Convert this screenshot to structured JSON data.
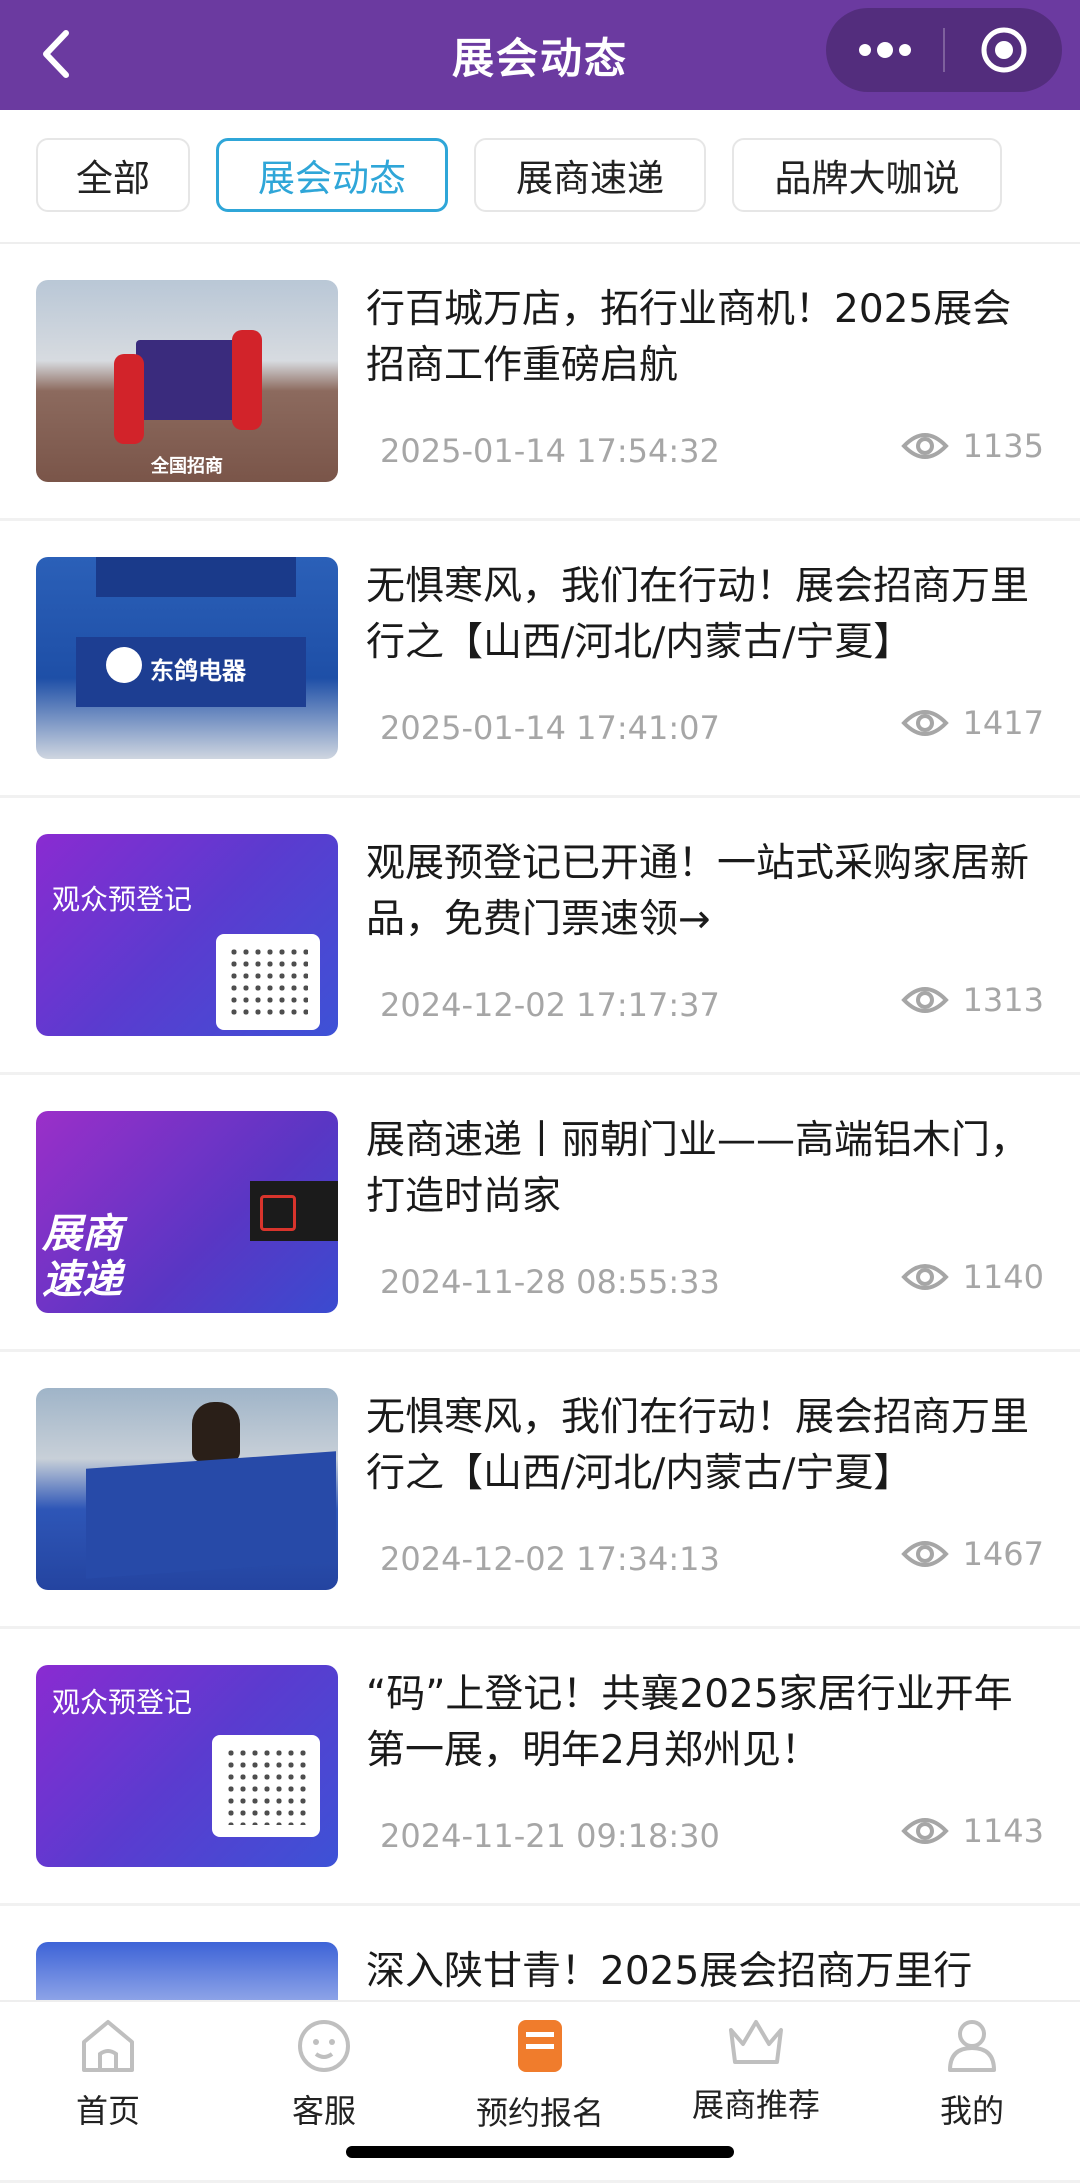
{
  "header": {
    "title": "展会动态"
  },
  "tabs": [
    {
      "label": "全部"
    },
    {
      "label": "展会动态"
    },
    {
      "label": "展商速递"
    },
    {
      "label": "品牌大咖说"
    }
  ],
  "articles": [
    {
      "title": "行百城万店，拓行业商机！2025展会招商工作重磅启航",
      "date": "2025-01-14 17:54:32",
      "views": "1135",
      "thumb_text": "全国招商"
    },
    {
      "title": "无惧寒风，我们在行动！展会招商万里行之【山西/河北/内蒙古/宁夏】",
      "date": "2025-01-14 17:41:07",
      "views": "1417",
      "thumb_text": "东鸽电器"
    },
    {
      "title": "观展预登记已开通！一站式采购家居新品，免费门票速领→",
      "date": "2024-12-02 17:17:37",
      "views": "1313",
      "thumb_text": "观众预登记"
    },
    {
      "title": "展商速递丨丽朝门业——高端铝木门，打造时尚家",
      "date": "2024-11-28 08:55:33",
      "views": "1140",
      "thumb_text": "展商速递"
    },
    {
      "title": "无惧寒风，我们在行动！展会招商万里行之【山西/河北/内蒙古/宁夏】",
      "date": "2024-12-02 17:34:13",
      "views": "1467",
      "thumb_text": ""
    },
    {
      "title": "“码”上登记！共襄2025家居行业开年第一展，明年2月郑州见！",
      "date": "2024-11-21 09:18:30",
      "views": "1143",
      "thumb_text": "观众预登记"
    },
    {
      "title": "深入陕甘青！2025展会招商万里行",
      "date": "",
      "views": "",
      "thumb_text": ""
    }
  ],
  "tabbar": [
    {
      "label": "首页",
      "icon": "home-icon"
    },
    {
      "label": "客服",
      "icon": "service-icon"
    },
    {
      "label": "预约报名",
      "icon": "booking-icon"
    },
    {
      "label": "展商推荐",
      "icon": "crown-icon"
    },
    {
      "label": "我的",
      "icon": "user-icon"
    }
  ],
  "colors": {
    "header": "#6b3aa0",
    "active_tab": "#2fa6d8",
    "active_nav": "#f07c2c"
  }
}
